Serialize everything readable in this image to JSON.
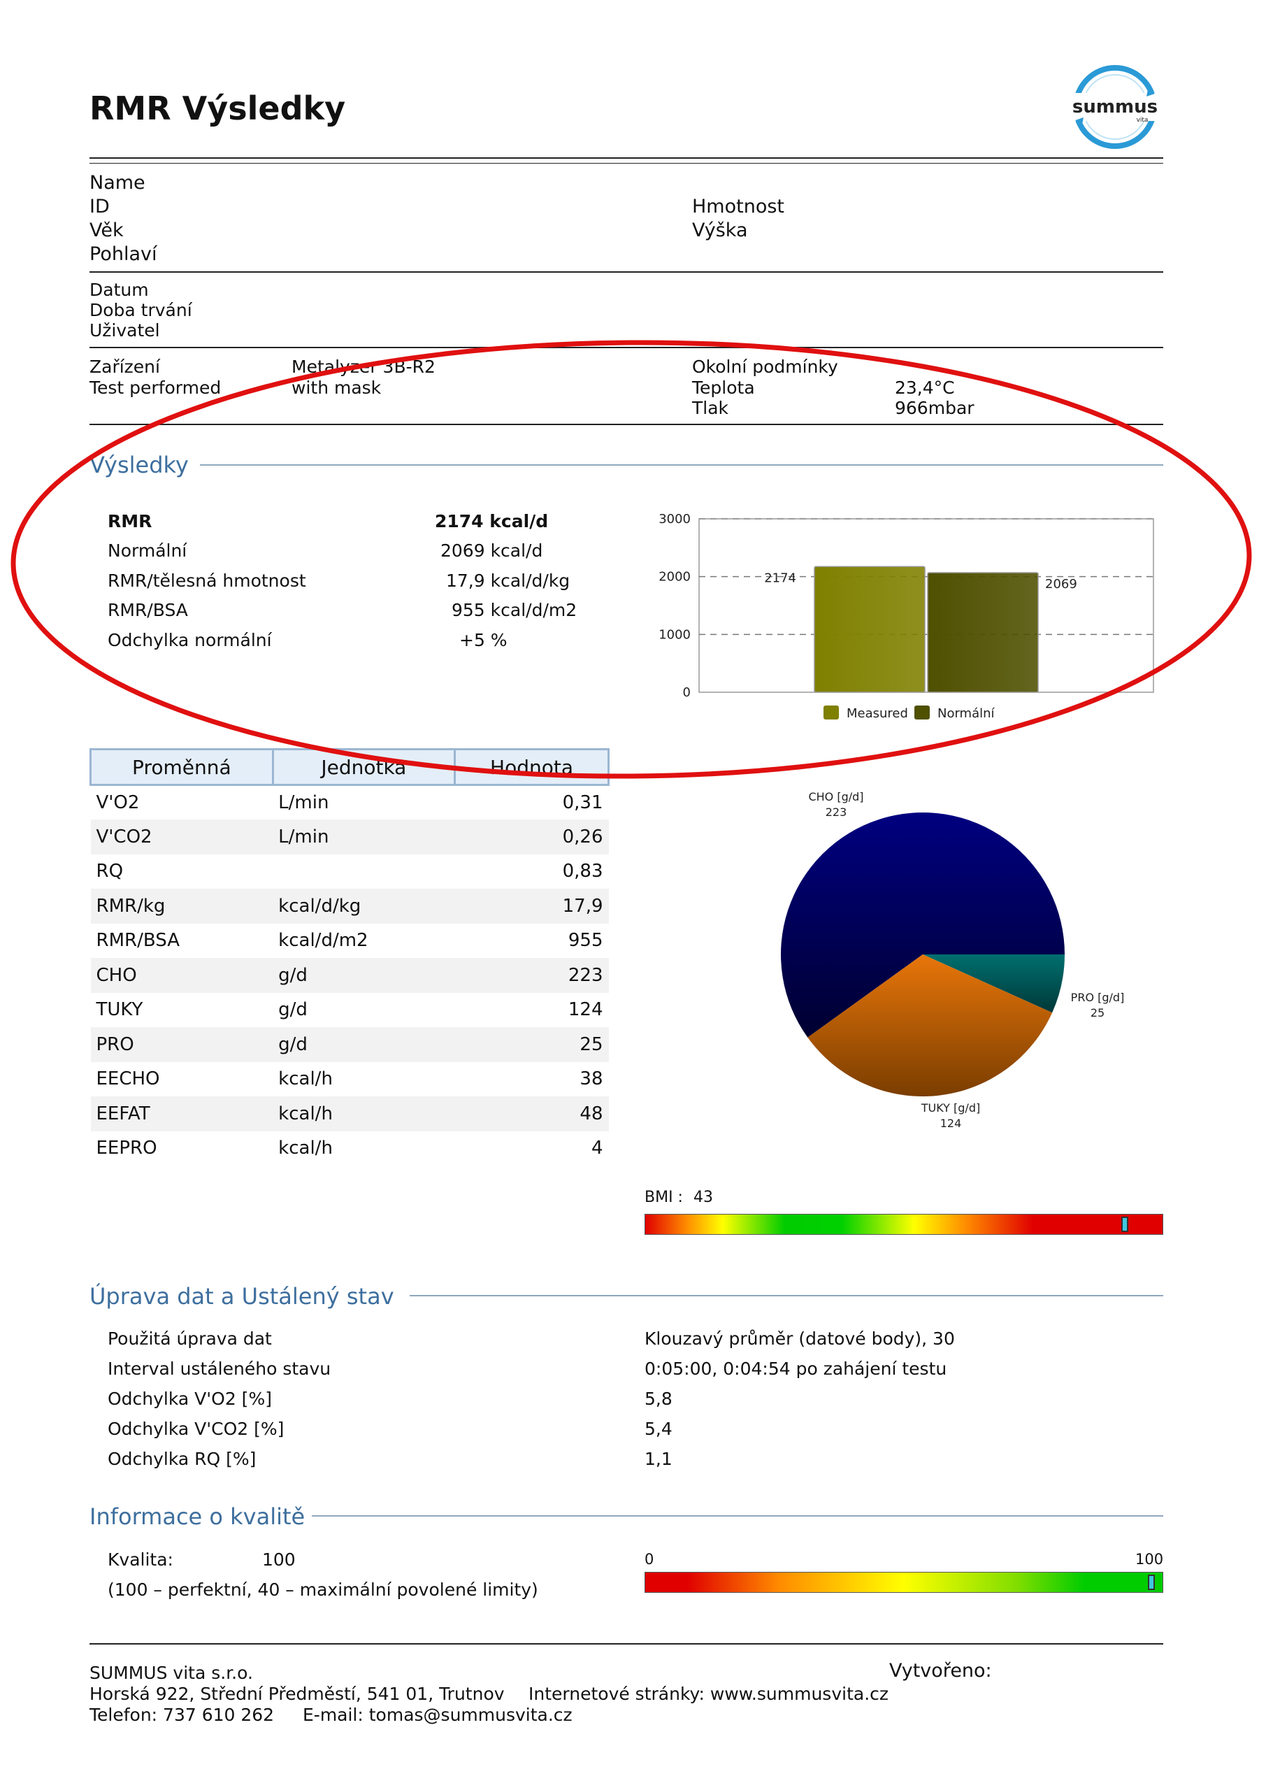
{
  "header": {
    "title": "RMR Výsledky",
    "logo_text": "summus",
    "logo_sub": "vita"
  },
  "patient": {
    "name_label": "Name",
    "id_label": "ID",
    "vek_label": "Věk",
    "pohlavi_label": "Pohlaví",
    "hmotnost_label": "Hmotnost",
    "vyska_label": "Výška"
  },
  "session": {
    "datum_label": "Datum",
    "doba_label": "Doba trvání",
    "uzivatel_label": "Uživatel"
  },
  "device": {
    "zarizeni_label": "Zařízení",
    "zarizeni_value": "Metalyzer 3B-R2",
    "test_label": "Test performed",
    "test_value": "with mask",
    "okolni_label": "Okolní podmínky",
    "teplota_label": "Teplota",
    "teplota_value": "23,4°C",
    "tlak_label": "Tlak",
    "tlak_value": "966mbar"
  },
  "results": {
    "section_title": "Výsledky",
    "rows": [
      {
        "label": "RMR",
        "value": "2174 kcal/d",
        "bold": true
      },
      {
        "label": "Normální",
        "value": "2069 kcal/d"
      },
      {
        "label": "RMR/tělesná hmotnost",
        "value": "17,9 kcal/d/kg"
      },
      {
        "label": "RMR/BSA",
        "value": "955 kcal/d/m2"
      },
      {
        "label": "Odchylka normální",
        "value": "+5 %"
      }
    ]
  },
  "chart_data": [
    {
      "type": "bar",
      "categories": [
        "Measured",
        "Normální"
      ],
      "values": [
        2174,
        2069
      ],
      "value_labels": [
        "2174",
        "2069"
      ],
      "ylim": [
        0,
        3000
      ],
      "yticks": [
        "0",
        "1000",
        "2000",
        "3000"
      ],
      "colors": [
        "#7f8000",
        "#4f5000"
      ],
      "legend": [
        "Measured",
        "Normální"
      ],
      "legend_position": "bottom",
      "grid": true
    },
    {
      "type": "pie",
      "slices": [
        {
          "label": "CHO [g/d]",
          "value": 223,
          "value_label": "223",
          "color": "#000080"
        },
        {
          "label": "PRO [g/d]",
          "value": 25,
          "value_label": "25",
          "color": "#006f6f"
        },
        {
          "label": "TUKY [g/d]",
          "value": 124,
          "value_label": "124",
          "color": "#e8760a"
        }
      ]
    }
  ],
  "variables": {
    "headers": [
      "Proměnná",
      "Jednotka",
      "Hodnota"
    ],
    "rows": [
      [
        "V'O2",
        "L/min",
        "0,31"
      ],
      [
        "V'CO2",
        "L/min",
        "0,26"
      ],
      [
        "RQ",
        "",
        "0,83"
      ],
      [
        "RMR/kg",
        "kcal/d/kg",
        "17,9"
      ],
      [
        "RMR/BSA",
        "kcal/d/m2",
        "955"
      ],
      [
        "CHO",
        "g/d",
        "223"
      ],
      [
        "TUKY",
        "g/d",
        "124"
      ],
      [
        "PRO",
        "g/d",
        "25"
      ],
      [
        "EECHO",
        "kcal/h",
        "38"
      ],
      [
        "EEFAT",
        "kcal/h",
        "48"
      ],
      [
        "EEPRO",
        "kcal/h",
        "4"
      ]
    ]
  },
  "bmi": {
    "label": "BMI :",
    "value": "43",
    "marker_fraction": 0.92
  },
  "steady": {
    "section_title": "Úprava dat a  Ustálený stav",
    "rows": [
      {
        "label": "Použitá úprava dat",
        "value": "Klouzavý průměr (datové  body), 30"
      },
      {
        "label": "Interval ustáleného stavu",
        "value": "0:05:00, 0:04:54 po zahájení testu"
      },
      {
        "label": "Odchylka V'O2 [%]",
        "value": "5,8"
      },
      {
        "label": "Odchylka V'CO2 [%]",
        "value": "5,4"
      },
      {
        "label": "Odchylka RQ [%]",
        "value": "1,1"
      }
    ]
  },
  "quality": {
    "section_title": "Informace o kvalitě",
    "kvalita_label": "Kvalita:",
    "kvalita_value": "100",
    "note": "(100 – perfektní, 40 – maximální povolené limity)",
    "scale_min": "0",
    "scale_max": "100",
    "marker_fraction": 0.985
  },
  "footer": {
    "company": "SUMMUS vita s.r.o.",
    "address": "Horská 922, Střední Předměstí, 541 01, Trutnov",
    "web": "Internetové stránky: www.summusvita.cz",
    "phone": "Telefon: 737 610 262",
    "email": "E-mail: tomas@summusvita.cz",
    "created_label": "Vytvořeno:"
  },
  "annotation": {
    "color": "#e01010"
  }
}
